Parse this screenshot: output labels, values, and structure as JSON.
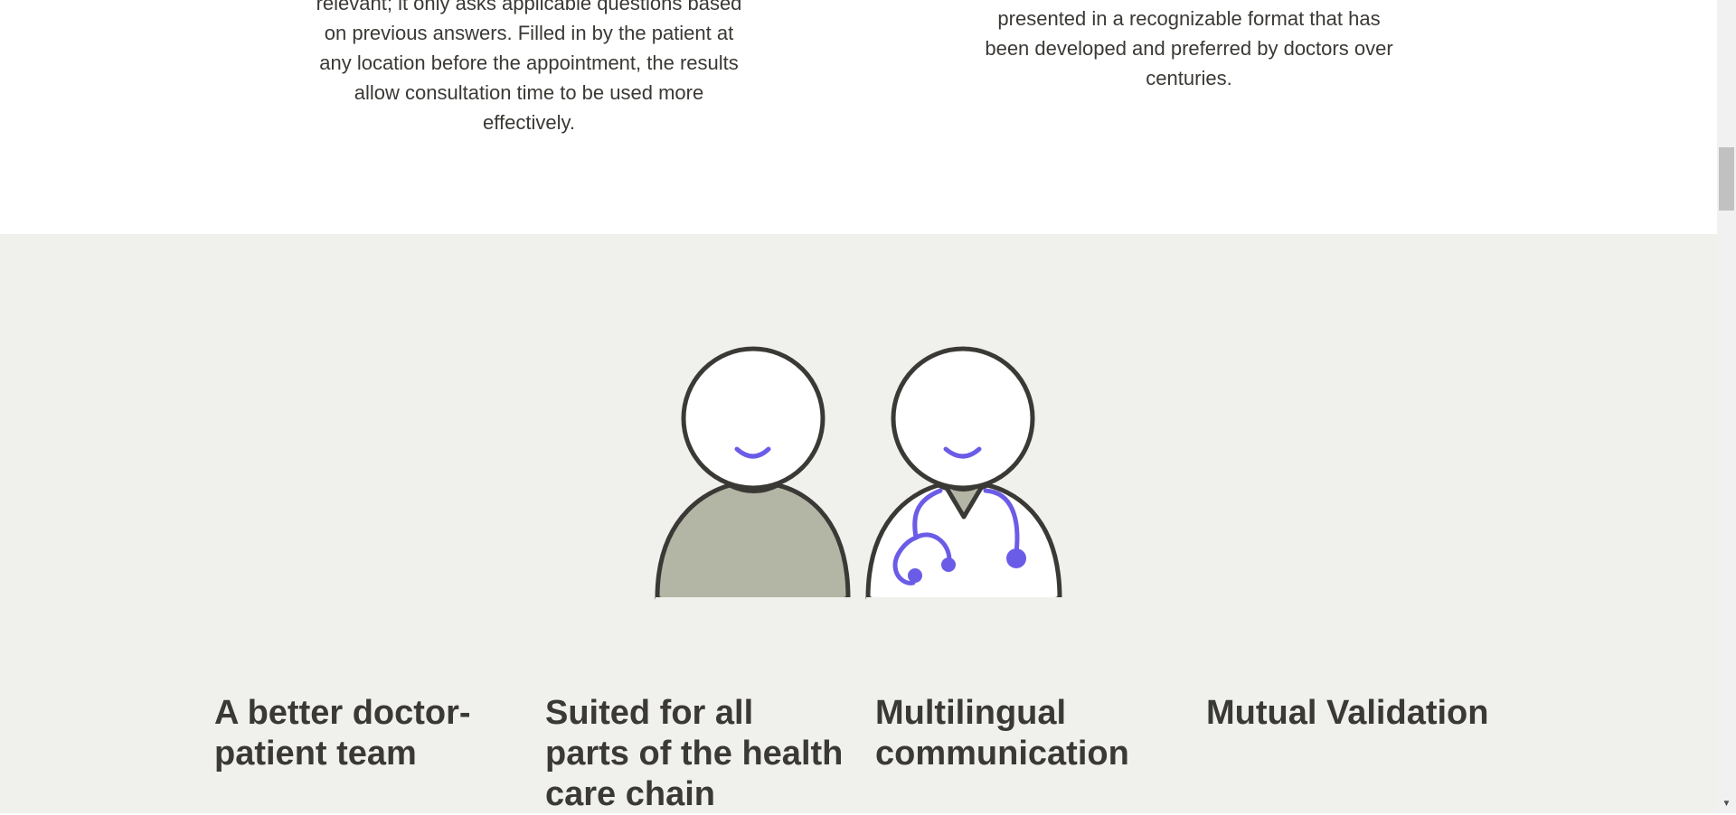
{
  "intro": {
    "left_text": "relevant; it only asks applicable questions based on previous answers. Filled in by the patient at any location before the appointment, the results allow consultation time to be used more effectively.",
    "right_text": "presented in a recognizable format that has been developed and preferred by doctors over centuries."
  },
  "illustration": {
    "patient_icon": "patient-icon",
    "doctor_icon": "doctor-icon",
    "stethoscope_icon": "stethoscope-icon"
  },
  "features": [
    {
      "title": "A better doctor-patient team"
    },
    {
      "title": "Suited for all parts of the health care chain"
    },
    {
      "title": "Multilingual communication"
    },
    {
      "title": "Mutual Validation"
    }
  ],
  "scrollbar": {
    "down_arrow": "▼"
  },
  "colors": {
    "accent": "#6b5ce7",
    "outline": "#3b3935",
    "patient_shirt": "#b3b5a5",
    "section_bg": "#f0f0ec"
  }
}
